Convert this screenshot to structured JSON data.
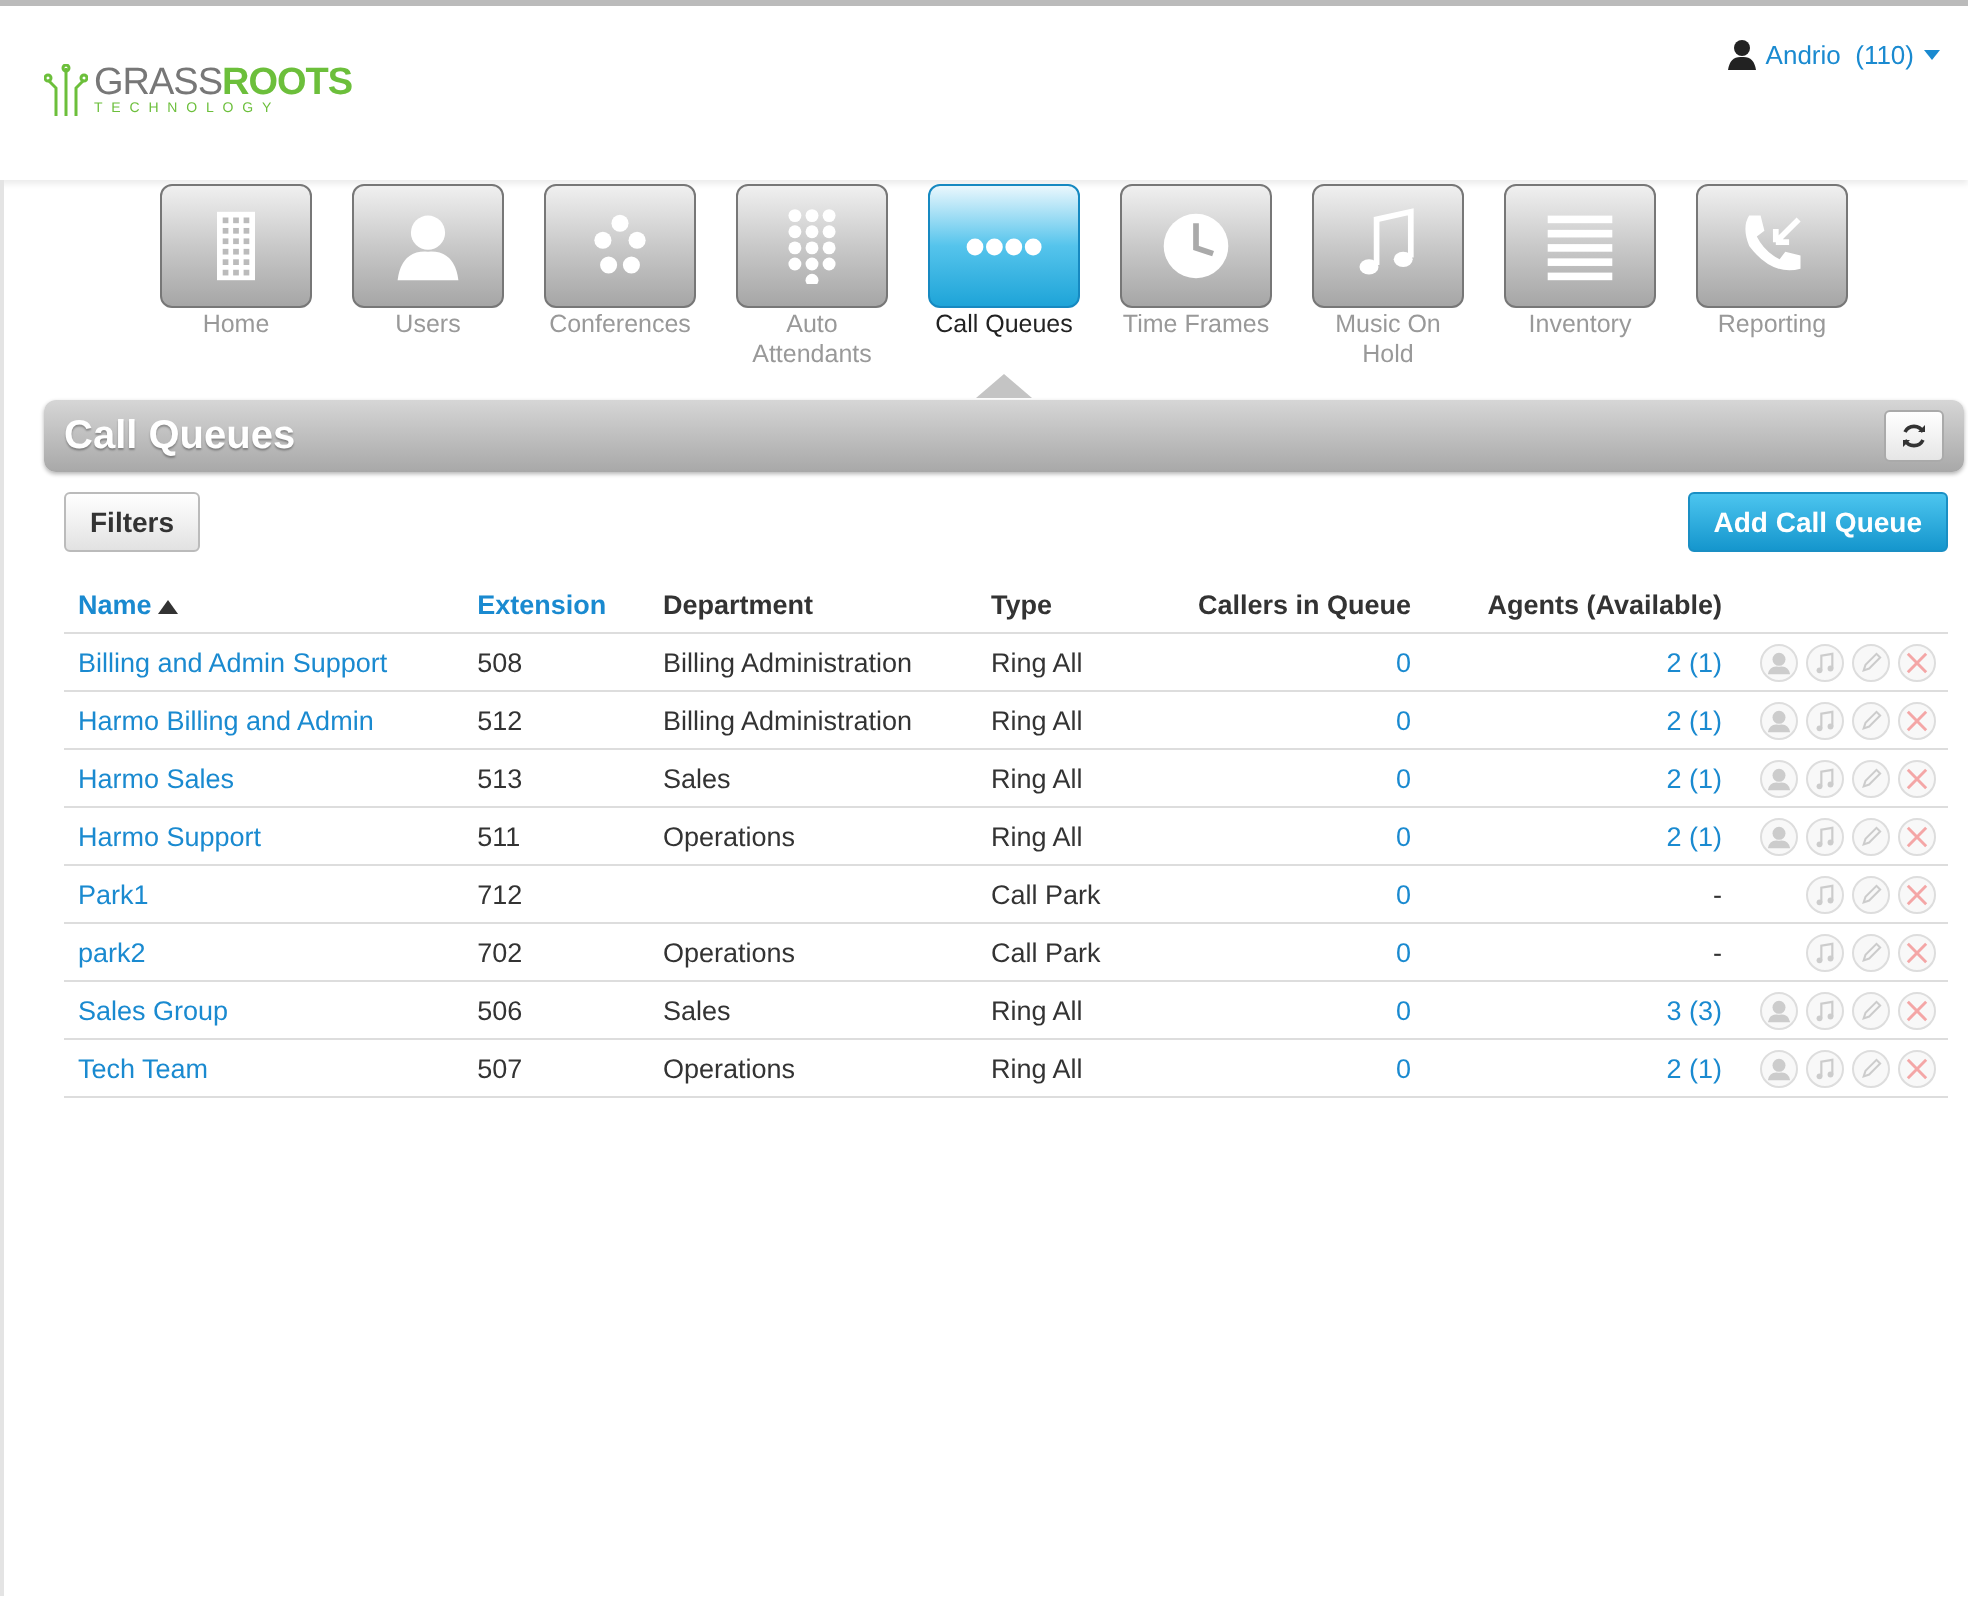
{
  "logo": {
    "word1": "GRASS",
    "word2": "ROOTS",
    "tagline": "TECHNOLOGY"
  },
  "user_menu": {
    "name": "Andrio",
    "extension": "(110)"
  },
  "nav": [
    {
      "label": "Home",
      "kind": "building",
      "selected": false
    },
    {
      "label": "Users",
      "kind": "user",
      "selected": false
    },
    {
      "label": "Conferences",
      "kind": "dots",
      "selected": false
    },
    {
      "label": "Auto Attendants",
      "kind": "keypad",
      "selected": false
    },
    {
      "label": "Call Queues",
      "kind": "queue",
      "selected": true
    },
    {
      "label": "Time Frames",
      "kind": "clock",
      "selected": false
    },
    {
      "label": "Music On Hold",
      "kind": "music",
      "selected": false
    },
    {
      "label": "Inventory",
      "kind": "list",
      "selected": false
    },
    {
      "label": "Reporting",
      "kind": "phone",
      "selected": false
    }
  ],
  "panel": {
    "title": "Call Queues"
  },
  "toolbar": {
    "filters": "Filters",
    "add": "Add Call Queue"
  },
  "table": {
    "columns": [
      {
        "label": "Name",
        "sortable": true,
        "sorted": true,
        "kind": "text"
      },
      {
        "label": "Extension",
        "sortable": true,
        "sorted": false,
        "kind": "text"
      },
      {
        "label": "Department",
        "sortable": false,
        "sorted": false,
        "kind": "text"
      },
      {
        "label": "Type",
        "sortable": false,
        "sorted": false,
        "kind": "text"
      },
      {
        "label": "Callers in Queue",
        "sortable": false,
        "sorted": false,
        "kind": "count"
      },
      {
        "label": "Agents (Available)",
        "sortable": false,
        "sorted": false,
        "kind": "count"
      }
    ],
    "rows": [
      {
        "name": "Billing and Admin Support",
        "extension": "508",
        "department": "Billing Administration",
        "type": "Ring All",
        "callers": "0",
        "agents": "2 (1)",
        "has_agents": true
      },
      {
        "name": "Harmo Billing and Admin",
        "extension": "512",
        "department": "Billing Administration",
        "type": "Ring All",
        "callers": "0",
        "agents": "2 (1)",
        "has_agents": true
      },
      {
        "name": "Harmo Sales",
        "extension": "513",
        "department": "Sales",
        "type": "Ring All",
        "callers": "0",
        "agents": "2 (1)",
        "has_agents": true
      },
      {
        "name": "Harmo Support",
        "extension": "511",
        "department": "Operations",
        "type": "Ring All",
        "callers": "0",
        "agents": "2 (1)",
        "has_agents": true
      },
      {
        "name": "Park1",
        "extension": "712",
        "type": "Call Park",
        "callers": "0",
        "agents": "-",
        "has_agents": false
      },
      {
        "name": "park2",
        "extension": "702",
        "department": "Operations",
        "type": "Call Park",
        "callers": "0",
        "agents": "-",
        "has_agents": false
      },
      {
        "name": "Sales Group",
        "extension": "506",
        "department": "Sales",
        "type": "Ring All",
        "callers": "0",
        "agents": "3 (3)",
        "has_agents": true
      },
      {
        "name": "Tech Team",
        "extension": "507",
        "department": "Operations",
        "type": "Ring All",
        "callers": "0",
        "agents": "2 (1)",
        "has_agents": true
      }
    ]
  }
}
